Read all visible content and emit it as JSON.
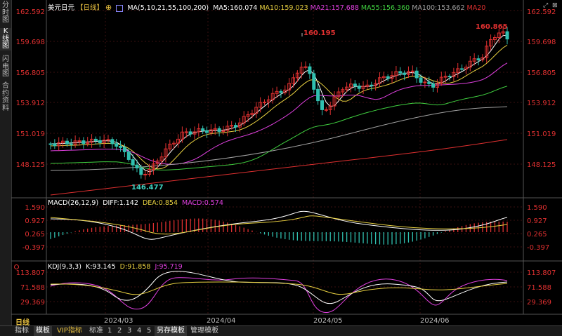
{
  "sidebar": {
    "tabs": [
      {
        "label": "分时图"
      },
      {
        "label": "K线图"
      },
      {
        "label": "闪电图"
      },
      {
        "label": "合约资料"
      }
    ]
  },
  "main": {
    "symbol": "美元日元",
    "period_tag": "【日线】",
    "ma_params": "MA(5,10,21,55,100,200)",
    "ma_values": [
      {
        "label": "MA5:160.074",
        "color": "#ffffff"
      },
      {
        "label": "MA10:159.023",
        "color": "#e8d040"
      },
      {
        "label": "MA21:157.688",
        "color": "#e040e0"
      },
      {
        "label": "MA55:156.360",
        "color": "#40d040"
      },
      {
        "label": "MA100:153.662",
        "color": "#a0a0a0"
      },
      {
        "label": "MA20",
        "color": "#e03030"
      }
    ],
    "price_ticks": [
      "162.592",
      "159.698",
      "156.805",
      "153.912",
      "151.019",
      "148.125"
    ],
    "high_label": "160.865",
    "mid_high_label": "160.195",
    "low_label": "146.477"
  },
  "macd": {
    "title": "MACD(26,12,9)",
    "diff": "DIFF:1.142",
    "dea": "DEA:0.854",
    "macd": "MACD:0.574",
    "ticks": [
      "1.590",
      "0.927",
      "0.265",
      "-0.397"
    ]
  },
  "kdj": {
    "title": "KDJ(9,3,3)",
    "k": "K:93.145",
    "d": "D:91.858",
    "j": "J:95.719",
    "ticks": [
      "113.807",
      "71.588",
      "29.369"
    ]
  },
  "x_axis": {
    "dates": [
      "2024/03",
      "2024/04",
      "2024/05",
      "2024/06"
    ]
  },
  "mode_label": "日线",
  "bottom_tabs": [
    {
      "label": "指标",
      "active": false
    },
    {
      "label": "模板",
      "active": true
    },
    {
      "label": "VIP指标",
      "active": false
    },
    {
      "label": "标准",
      "active": false
    },
    {
      "label": "1",
      "active": false
    },
    {
      "label": "2",
      "active": false
    },
    {
      "label": "3",
      "active": false
    },
    {
      "label": "4",
      "active": false
    },
    {
      "label": "5",
      "active": false
    },
    {
      "label": "另存模板",
      "active": true
    },
    {
      "label": "管理模板",
      "active": false
    }
  ],
  "colors": {
    "up": "#e03030",
    "down": "#30c0b0",
    "grid": "#3a1010"
  }
}
